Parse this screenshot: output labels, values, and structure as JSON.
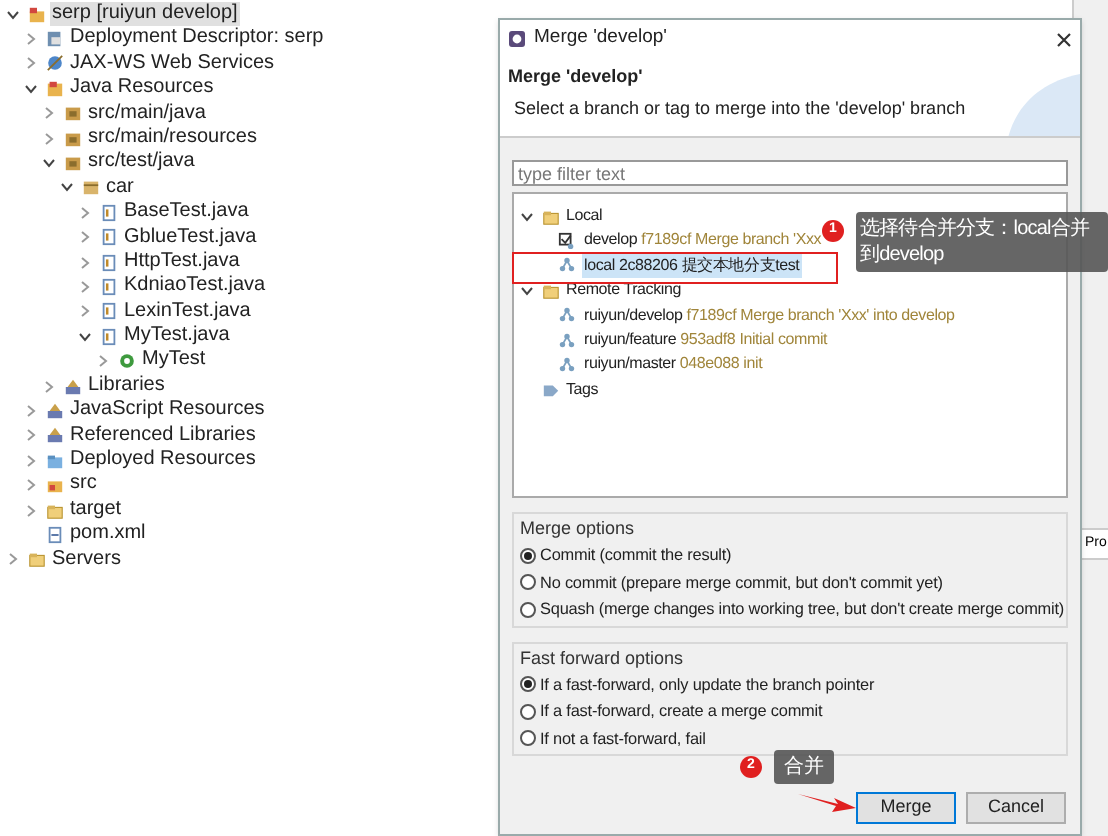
{
  "project_tree": [
    {
      "label": "serp [ruiyun develop]",
      "kind": "project",
      "expanded": true,
      "selected": true,
      "children": [
        {
          "label": "Deployment Descriptor: serp",
          "kind": "descriptor",
          "expanded": false,
          "selected": false
        },
        {
          "label": "JAX-WS Web Services",
          "kind": "webservice",
          "expanded": false,
          "selected": false
        },
        {
          "label": "Java Resources",
          "kind": "resources",
          "expanded": true,
          "selected": false,
          "children": [
            {
              "label": "src/main/java",
              "kind": "source",
              "expanded": false,
              "selected": false
            },
            {
              "label": "src/main/resources",
              "kind": "source",
              "expanded": false,
              "selected": false
            },
            {
              "label": "src/test/java",
              "kind": "source",
              "expanded": true,
              "selected": false,
              "children": [
                {
                  "label": "car",
                  "kind": "package",
                  "expanded": true,
                  "selected": false,
                  "children": [
                    {
                      "label": "BaseTest.java",
                      "kind": "java",
                      "expanded": false,
                      "selected": false
                    },
                    {
                      "label": "GblueTest.java",
                      "kind": "java",
                      "expanded": false,
                      "selected": false
                    },
                    {
                      "label": "HttpTest.java",
                      "kind": "java",
                      "expanded": false,
                      "selected": false
                    },
                    {
                      "label": "KdniaoTest.java",
                      "kind": "java",
                      "expanded": false,
                      "selected": false
                    },
                    {
                      "label": "LexinTest.java",
                      "kind": "java",
                      "expanded": false,
                      "selected": false
                    },
                    {
                      "label": "MyTest.java",
                      "kind": "java",
                      "expanded": true,
                      "selected": false,
                      "children": [
                        {
                          "label": "MyTest",
                          "kind": "class",
                          "expanded": false,
                          "selected": false
                        }
                      ]
                    }
                  ]
                }
              ]
            },
            {
              "label": "Libraries",
              "kind": "library",
              "expanded": false,
              "selected": false
            }
          ]
        },
        {
          "label": "JavaScript Resources",
          "kind": "library",
          "expanded": false,
          "selected": false
        },
        {
          "label": "Referenced Libraries",
          "kind": "library",
          "expanded": false,
          "selected": false
        },
        {
          "label": "Deployed Resources",
          "kind": "deployed",
          "expanded": false,
          "selected": false
        },
        {
          "label": "src",
          "kind": "srcfolder",
          "expanded": false,
          "selected": false
        },
        {
          "label": "target",
          "kind": "folder",
          "expanded": false,
          "selected": false
        },
        {
          "label": "pom.xml",
          "kind": "xml",
          "selected": false
        }
      ]
    },
    {
      "label": "Servers",
      "kind": "folder",
      "expanded": false,
      "selected": false
    }
  ],
  "background_window": {
    "column_text": "Pro"
  },
  "dialog": {
    "title": "Merge 'develop'",
    "heading": "Merge 'develop'",
    "description": "Select a branch or tag to merge into the 'develop' branch",
    "filter": {
      "placeholder": "type filter text"
    },
    "branches": [
      {
        "label": "Local",
        "kind": "folder",
        "expanded": true,
        "children": [
          {
            "label": "develop",
            "commit": "f7189cf",
            "message": "Merge branch 'Xxx",
            "kind": "head",
            "selected": false
          },
          {
            "label": "local",
            "commit": "2c88206",
            "message": "提交本地分支test",
            "kind": "branch",
            "selected": true
          }
        ]
      },
      {
        "label": "Remote Tracking",
        "kind": "folder",
        "expanded": true,
        "children": [
          {
            "label": "ruiyun/develop",
            "commit": "f7189cf",
            "message": "Merge branch 'Xxx' into develop",
            "kind": "branch",
            "selected": false
          },
          {
            "label": "ruiyun/feature",
            "commit": "953adf8",
            "message": "Initial commit",
            "kind": "branch",
            "selected": false
          },
          {
            "label": "ruiyun/master",
            "commit": "048e088",
            "message": "init",
            "kind": "branch",
            "selected": false
          }
        ]
      },
      {
        "label": "Tags",
        "kind": "tags"
      }
    ],
    "option_groups": [
      {
        "title": "Merge options",
        "options": [
          {
            "label": "Commit (commit the result)",
            "selected": true
          },
          {
            "label": "No commit (prepare merge commit, but don't commit yet)",
            "selected": false
          },
          {
            "label": "Squash (merge changes into working tree, but don't create merge commit)",
            "selected": false
          }
        ]
      },
      {
        "title": "Fast forward options",
        "options": [
          {
            "label": "If a fast-forward, only update the branch pointer",
            "selected": true
          },
          {
            "label": "If a fast-forward, create a merge commit",
            "selected": false
          },
          {
            "label": "If not a fast-forward, fail",
            "selected": false
          }
        ]
      }
    ],
    "buttons": [
      {
        "label": "Merge",
        "default": true
      },
      {
        "label": "Cancel",
        "default": false
      }
    ]
  },
  "annotations": [
    {
      "number": "1",
      "text": "选择待合并分支：local合并到develop"
    },
    {
      "number": "2",
      "text": "合并"
    }
  ]
}
